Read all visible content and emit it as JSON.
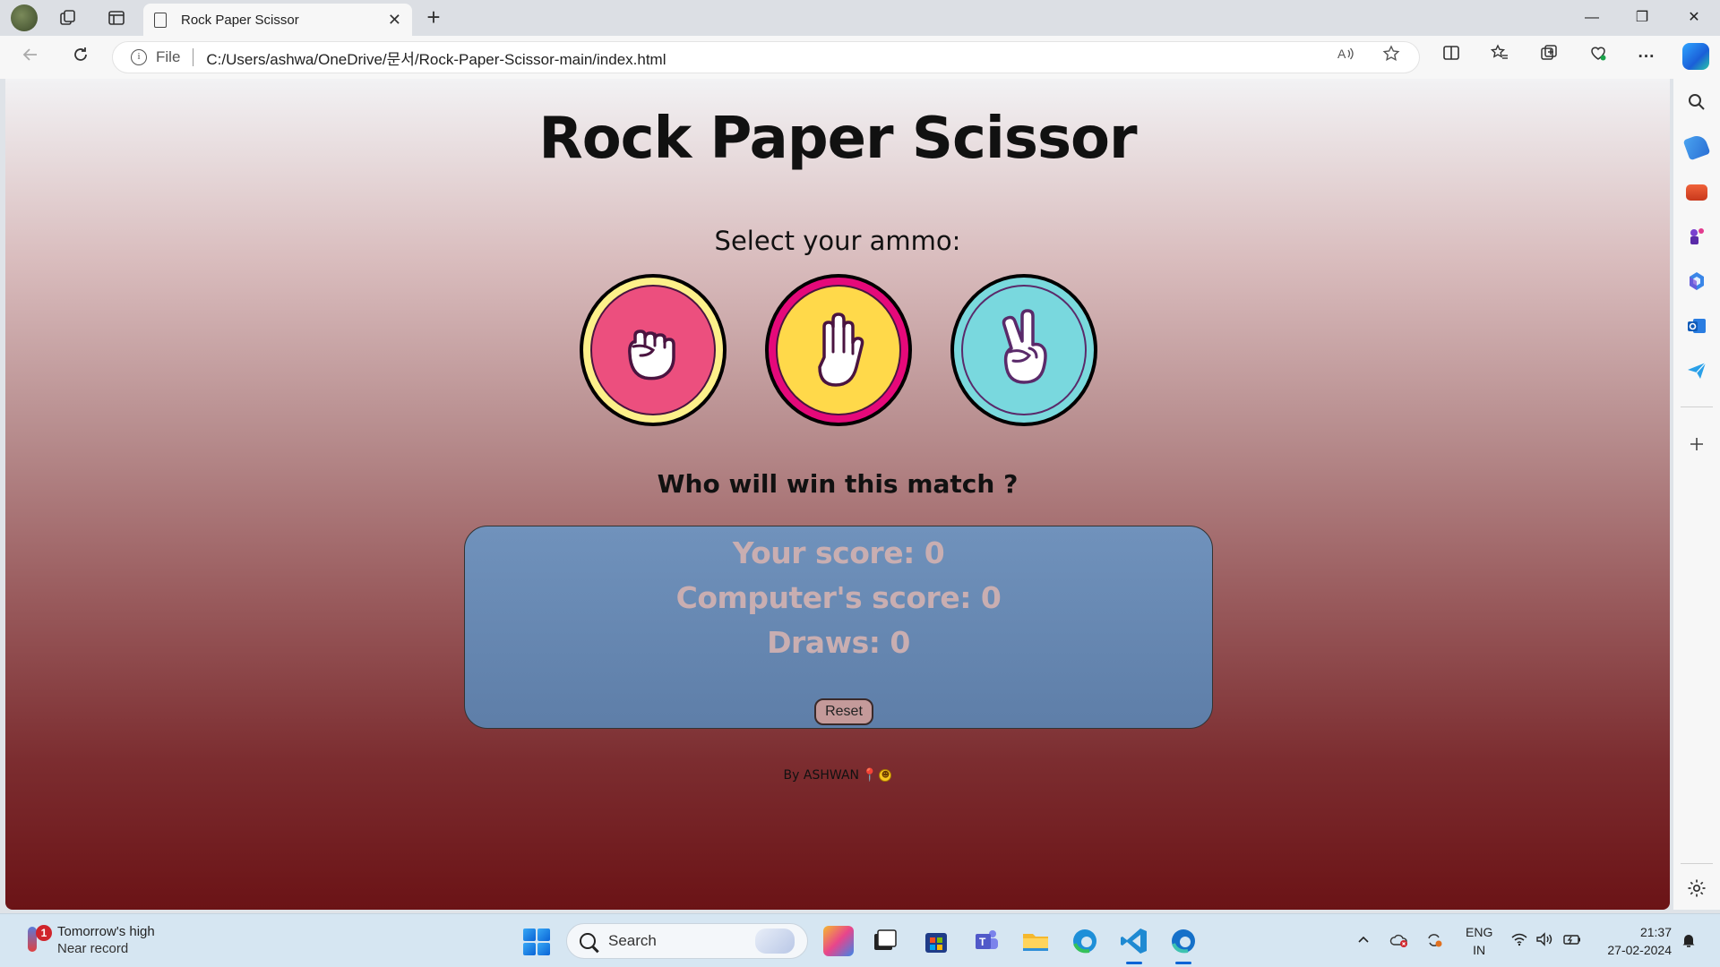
{
  "browser": {
    "tab_title": "Rock Paper Scissor",
    "tab_close": "✕",
    "new_tab": "+",
    "scheme": "File",
    "url": "C:/Users/ashwa/OneDrive/문서/Rock-Paper-Scissor-main/index.html",
    "window_controls": {
      "minimize": "—",
      "restore": "❐",
      "close": "✕"
    }
  },
  "page": {
    "title": "Rock Paper Scissor",
    "select_prompt": "Select your ammo:",
    "choices": [
      "rock",
      "paper",
      "scissor"
    ],
    "match_question": "Who will win this match ?",
    "score": {
      "your_score": "Your score: 0",
      "computer_score": "Computer's score: 0",
      "draws": "Draws: 0",
      "reset_label": "Reset"
    },
    "credit": "By ASHWAN",
    "credit_pin": "📍"
  },
  "taskbar": {
    "weather_title": "Tomorrow's high",
    "weather_sub": "Near record",
    "weather_badge": "1",
    "search_label": "Search",
    "language_line1": "ENG",
    "language_line2": "IN",
    "time": "21:37",
    "date": "27-02-2024"
  },
  "colors": {
    "rock_outer": "#fdf08a",
    "rock_inner": "#ec4f7e",
    "paper_outer": "#e5097a",
    "paper_inner": "#ffd94a",
    "scissor": "#7ad9dd",
    "score_box": "#6a8bb4",
    "score_text": "#c9aeb1"
  }
}
